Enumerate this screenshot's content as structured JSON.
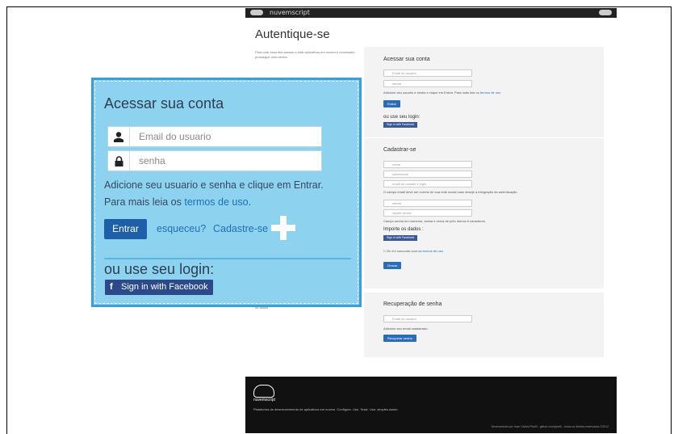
{
  "header": {
    "brand": "nuvemscript"
  },
  "page": {
    "title": "Autentique-se",
    "intro": "Para criar essa tela acesse a total aplicativos em nuvem é necessário prosseguir uma senha.",
    "bottom_note": "os dados"
  },
  "login_panel": {
    "title": "Acessar sua conta",
    "email_placeholder": "Email do usuario",
    "password_placeholder": "senha",
    "help_text": "Adicione seu usuario e senha e clique em Entrar. Para mais leia os",
    "terms_link": "termos de uso",
    "help_suffix": ".",
    "enter_label": "Entrar",
    "forgot_label": "esqueceu?",
    "register_label": "Cadastre-se",
    "alt_title": "ou use seu login:",
    "facebook_label": "Sign in with Facebook",
    "small_alt_title": "ou use seu login:",
    "small_fb": "Sign in with Facebook",
    "small_enter": "Entrar"
  },
  "register_panel": {
    "title": "Cadastrar-se",
    "fields": [
      "nome",
      "sobrenome",
      "email de contato e login",
      "senha",
      "repetir senha"
    ],
    "email_note": "O campo email deve ser correto de sua rede social caso deseje a integração da autenticação.",
    "password_note": "Campo senha em números, acima e cerca de pelo menos 6 caracteres.",
    "import_title": "Importe os dados :",
    "import_fb": "Sign in with Facebook",
    "terms_check": "Eu li e concordo com os",
    "terms_link": "termos de uso.",
    "save_label": "Gravar"
  },
  "recovery_panel": {
    "title": "Recuperação de senha",
    "email_placeholder": "Email do usuario",
    "note": "Adicione seu email cadastrado.",
    "button": "Recuperar senha"
  },
  "footer": {
    "brand": "nuvemscript",
    "description": "Plataforma de desenvolvimento de aplicativos em nuvem. Configure. Use. Teste. Use, simples assim.",
    "credits": "Desenvolvido por Jean Carlos Pinelli - github.com/pinelli - todos os direitos reservados ©2012"
  },
  "colors": {
    "overlay_bg": "#8dd3f0",
    "overlay_border": "#3aa0d8",
    "primary": "#1e5fa8",
    "link": "#1f6fb5",
    "facebook": "#2c4a8a"
  }
}
